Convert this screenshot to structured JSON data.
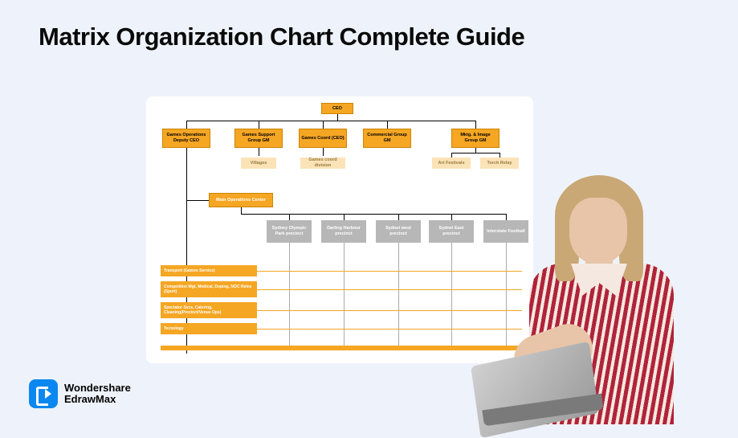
{
  "title": "Matrix Organization Chart  Complete Guide",
  "brand": {
    "line1": "Wondershare",
    "line2": "EdrawMax"
  },
  "org": {
    "top": "CEO",
    "level2": [
      {
        "label": "Games Operations Deputy CEO"
      },
      {
        "label": "Games Support Group GM"
      },
      {
        "label": "Games Coord (CEO)"
      },
      {
        "label": "Commercial Group GM"
      },
      {
        "label": "Mktg. & Image Group GM"
      }
    ],
    "level3": [
      {
        "label": "Villages"
      },
      {
        "label": "Games coord division"
      },
      {
        "label": "Art Festivals"
      },
      {
        "label": "Torch Relay"
      }
    ],
    "main_center": "Main Operations Center",
    "precincts": [
      {
        "label": "Sydney Olympic Park precinct"
      },
      {
        "label": "Darling Harbour precinct"
      },
      {
        "label": "Sydnei west precinct"
      },
      {
        "label": "Sydnei East precinct"
      },
      {
        "label": "Interstate Football"
      }
    ],
    "rows": [
      {
        "label": "Transport (Games Service)"
      },
      {
        "label": "Competition Mgt, Medical, Doping, NOC Relns (Sport)"
      },
      {
        "label": "Spectator Svcs, Catering, Cleaning(Precinct/Venue Ops)"
      },
      {
        "label": "Tecnology"
      }
    ]
  },
  "chart_data": {
    "type": "org-matrix",
    "root": "CEO",
    "divisions": [
      "Games Operations Deputy CEO",
      "Games Support Group GM",
      "Games Coord (CEO)",
      "Commercial Group GM",
      "Mktg. & Image Group GM"
    ],
    "sub_units": {
      "Games Support Group GM": [
        "Villages"
      ],
      "Games Coord (CEO)": [
        "Games coord division"
      ],
      "Mktg. & Image Group GM": [
        "Art Festivals",
        "Torch Relay"
      ]
    },
    "matrix_center": "Main Operations Center",
    "matrix_columns": [
      "Sydney Olympic Park precinct",
      "Darling Harbour precinct",
      "Sydnei west precinct",
      "Sydnei East precinct",
      "Interstate Football"
    ],
    "matrix_rows": [
      "Transport (Games Service)",
      "Competition Mgt, Medical, Doping, NOC Relns (Sport)",
      "Spectator Svcs, Catering, Cleaning(Precinct/Venue Ops)",
      "Tecnology"
    ]
  }
}
